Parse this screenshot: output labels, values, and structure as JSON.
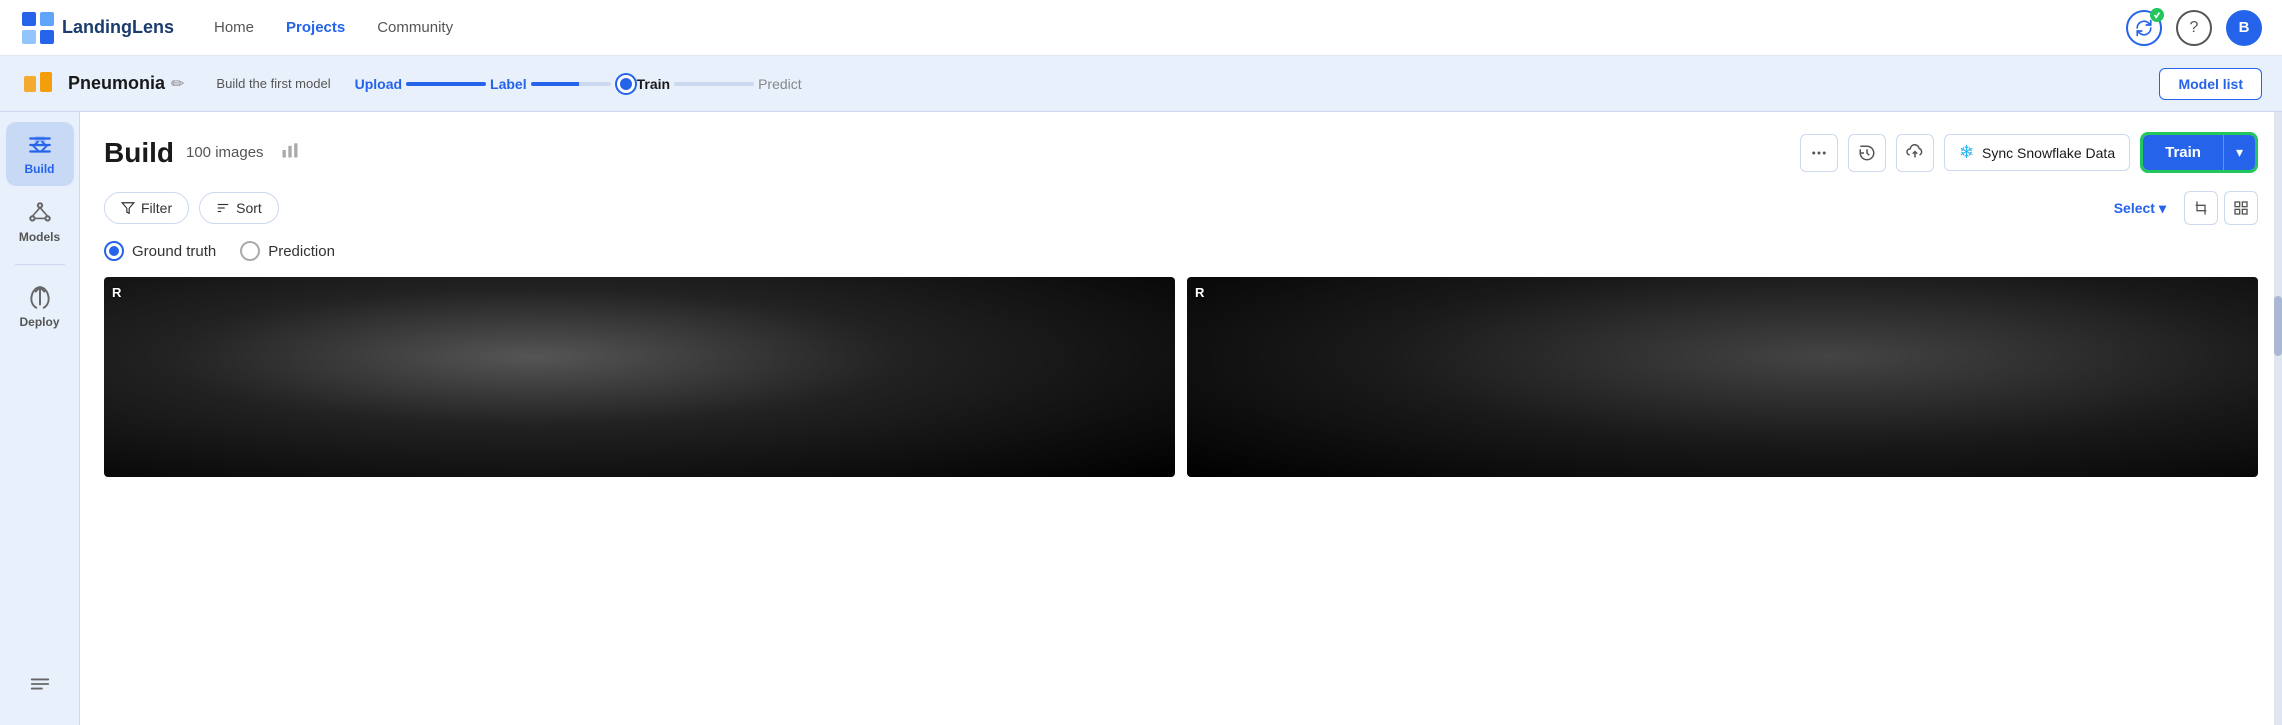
{
  "navbar": {
    "logo_text": "LandingLens",
    "nav_items": [
      {
        "label": "Home",
        "active": false
      },
      {
        "label": "Projects",
        "active": true
      },
      {
        "label": "Community",
        "active": false
      }
    ],
    "avatar_letter": "B"
  },
  "subheader": {
    "project_name": "Pneumonia",
    "pipeline_label": "Build the first model",
    "steps": [
      {
        "label": "Upload",
        "state": "done"
      },
      {
        "label": "Label",
        "state": "done"
      },
      {
        "label": "Train",
        "state": "active"
      },
      {
        "label": "Predict",
        "state": "inactive"
      }
    ],
    "model_list_btn": "Model list"
  },
  "sidebar": {
    "items": [
      {
        "label": "Build",
        "active": true
      },
      {
        "label": "Models",
        "active": false
      },
      {
        "label": "Deploy",
        "active": false
      }
    ]
  },
  "build": {
    "title": "Build",
    "image_count": "100 images",
    "filter_btn": "Filter",
    "sort_btn": "Sort",
    "sync_snowflake_btn": "Sync Snowflake Data",
    "train_btn": "Train",
    "select_btn": "Select",
    "ground_truth_label": "Ground truth",
    "prediction_label": "Prediction",
    "image_labels": [
      "R",
      "R"
    ]
  }
}
